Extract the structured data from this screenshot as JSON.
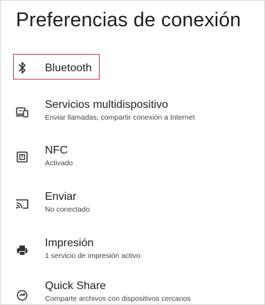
{
  "header": {
    "title": "Preferencias de conexión"
  },
  "items": [
    {
      "icon": "bluetooth-icon",
      "title": "Bluetooth",
      "subtitle": ""
    },
    {
      "icon": "multidevice-icon",
      "title": "Servicios multidispositivo",
      "subtitle": "Enviar llamadas, compartir conexión a Internet"
    },
    {
      "icon": "nfc-icon",
      "title": "NFC",
      "subtitle": "Activado"
    },
    {
      "icon": "cast-icon",
      "title": "Enviar",
      "subtitle": "No conectado"
    },
    {
      "icon": "printer-icon",
      "title": "Impresión",
      "subtitle": "1 servicio de impresión activo"
    },
    {
      "icon": "quick-share-icon",
      "title": "Quick Share",
      "subtitle": "Comparte archivos con dispositivos cercanos"
    }
  ],
  "colors": {
    "highlight": "#d9363e",
    "text": "#1f1f1f",
    "subtitle": "#444444"
  }
}
